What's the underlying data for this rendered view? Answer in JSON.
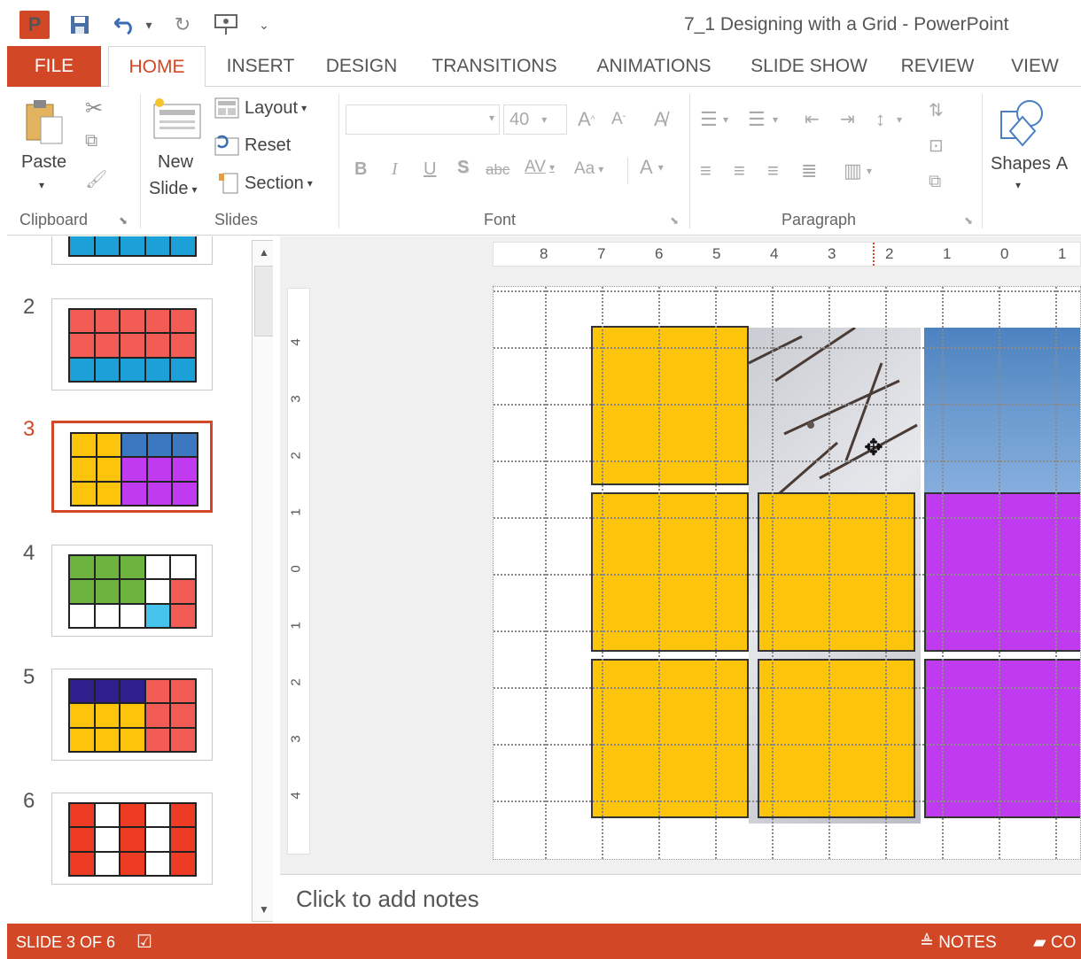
{
  "window": {
    "title": "7_1 Designing with a Grid - PowerPoint",
    "app_icon": "P",
    "accent_color": "#d24726"
  },
  "quick_access": [
    {
      "name": "save-icon",
      "glyph": "🖫"
    },
    {
      "name": "undo-icon",
      "glyph": "↶"
    },
    {
      "name": "redo-icon",
      "glyph": "↻"
    },
    {
      "name": "present-icon",
      "glyph": "⎚"
    },
    {
      "name": "customize-icon",
      "glyph": "⌄"
    }
  ],
  "tabs": [
    "FILE",
    "HOME",
    "INSERT",
    "DESIGN",
    "TRANSITIONS",
    "ANIMATIONS",
    "SLIDE SHOW",
    "REVIEW",
    "VIEW"
  ],
  "active_tab": "HOME",
  "ribbon": {
    "clipboard": {
      "label": "Clipboard",
      "paste": "Paste"
    },
    "slides": {
      "label": "Slides",
      "new_slide_line1": "New",
      "new_slide_line2": "Slide",
      "layout": "Layout",
      "reset": "Reset",
      "section": "Section"
    },
    "font": {
      "label": "Font",
      "font_size": "40",
      "bold": "B",
      "italic": "I",
      "underline": "U",
      "shadow": "S",
      "strike": "abc",
      "spacing": "AV",
      "case": "Aa",
      "grow": "A",
      "shrink": "A",
      "color": "A"
    },
    "paragraph": {
      "label": "Paragraph"
    },
    "drawing": {
      "shapes": "Shapes",
      "arrange_initial": "A"
    }
  },
  "thumbnails": [
    {
      "num": "2",
      "selected": false,
      "cells": [
        "#f25c54",
        "#f25c54",
        "#f25c54",
        "#f25c54",
        "#f25c54",
        "#f25c54",
        "#f25c54",
        "#f25c54",
        "#f25c54",
        "#f25c54",
        "#1ba0d8",
        "#1ba0d8",
        "#1ba0d8",
        "#1ba0d8",
        "#1ba0d8"
      ]
    },
    {
      "num": "3",
      "selected": true,
      "cells": [
        "#fcc40b",
        "#fcc40b",
        "#3c78bf",
        "#3c78bf",
        "#3c78bf",
        "#fcc40b",
        "#fcc40b",
        "#c03bf0",
        "#c03bf0",
        "#c03bf0",
        "#fcc40b",
        "#fcc40b",
        "#c03bf0",
        "#c03bf0",
        "#c03bf0"
      ]
    },
    {
      "num": "4",
      "selected": false,
      "cells": [
        "#6cb33f",
        "#6cb33f",
        "#6cb33f",
        "#ffffff",
        "#ffffff",
        "#6cb33f",
        "#6cb33f",
        "#6cb33f",
        "#ffffff",
        "#f25c54",
        "#ffffff",
        "#ffffff",
        "#ffffff",
        "#45c3ed",
        "#f25c54"
      ]
    },
    {
      "num": "5",
      "selected": false,
      "cells": [
        "#2e1f8c",
        "#2e1f8c",
        "#2e1f8c",
        "#f25c54",
        "#f25c54",
        "#fcc40b",
        "#fcc40b",
        "#fcc40b",
        "#f25c54",
        "#f25c54",
        "#fcc40b",
        "#fcc40b",
        "#fcc40b",
        "#f25c54",
        "#f25c54"
      ]
    },
    {
      "num": "6",
      "selected": false,
      "cells": [
        "#ee3b23",
        "#ffffff",
        "#ee3b23",
        "#ffffff",
        "#ee3b23",
        "#ee3b23",
        "#ffffff",
        "#ee3b23",
        "#ffffff",
        "#ee3b23",
        "#ee3b23",
        "#ffffff",
        "#ee3b23",
        "#ffffff",
        "#ee3b23"
      ]
    }
  ],
  "partial_thumb_color": "#1ba0d8",
  "rulers": {
    "horizontal": [
      "8",
      "7",
      "6",
      "5",
      "4",
      "3",
      "2",
      "1",
      "0",
      "1"
    ],
    "vertical": [
      "4",
      "3",
      "2",
      "1",
      "0",
      "1",
      "2",
      "3",
      "4"
    ]
  },
  "slide_colors": {
    "yellow": "#fcc40b",
    "purple": "#c03bf0"
  },
  "notes": {
    "placeholder": "Click to add notes"
  },
  "status": {
    "slide_count": "SLIDE 3 OF 6",
    "notes_button": "NOTES",
    "comments_button": "CO"
  }
}
